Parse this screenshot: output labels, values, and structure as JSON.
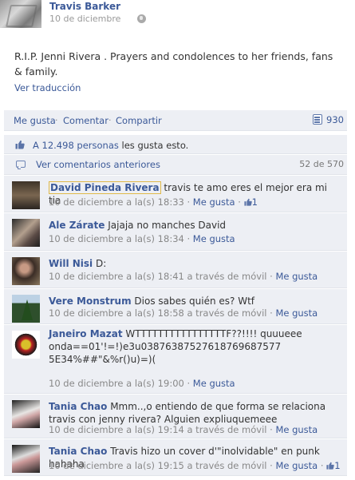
{
  "post": {
    "author": "Travis Barker",
    "date": "10 de diciembre",
    "text": "R.I.P. Jenni Rivera . Prayers and condolences to her friends, fans & family.",
    "translate_label": "Ver traducción"
  },
  "actions": {
    "like": "Me gusta",
    "comment": "Comentar",
    "share": "Compartir",
    "sep": "·",
    "share_count": "930"
  },
  "likes": {
    "count_link": "A 12.498 personas",
    "suffix": " les gusta esto."
  },
  "view_more": {
    "label": "Ver comentarios anteriores",
    "count": "52 de 570"
  },
  "comments": [
    {
      "name": "David Pineda Rivera",
      "text": "travis te amo eres el mejor era mi tia",
      "time": "10 de diciembre a la(s) 18:33",
      "sep": " · ",
      "like": "Me gusta",
      "likes": "1"
    },
    {
      "name": "Ale Zárate",
      "text": "Jajaja no manches David",
      "time": "10 de diciembre a la(s) 18:34",
      "sep": " · ",
      "like": "Me gusta"
    },
    {
      "name": "Will Nisi",
      "text": "D:",
      "time": "10 de diciembre a la(s) 18:41 a través de móvil",
      "sep": " · ",
      "like": "Me gusta"
    },
    {
      "name": "Vere Monstrum",
      "text": "Dios sabes quién es? Wtf",
      "time": "10 de diciembre a la(s) 18:58 a través de móvil",
      "sep": " · ",
      "like": "Me gusta"
    },
    {
      "name": "Janeiro Mazat",
      "text": "WTTTTTTTTTTTTTTTTF??!!!! quuueee onda==01'!=!)e3u03876387527618769687577 5E34%##\"&%r()u)=)(",
      "time": "10 de diciembre a la(s) 19:00",
      "sep": " · ",
      "like": "Me gusta"
    },
    {
      "name": "Tania Chao",
      "text": "Mmm..,o entiendo de que forma se relaciona travis con jenny rivera? Alguien expliuquemeee",
      "time": "10 de diciembre a la(s) 19:14 a través de móvil",
      "sep": " · ",
      "like": "Me gusta"
    },
    {
      "name": "Tania Chao",
      "text": "Travis hizo un cover d'\"inolvidable\" en punk hahaha",
      "time": "10 de diciembre a la(s) 19:15 a través de móvil",
      "sep": " · ",
      "like": "Me gusta",
      "likes": "1"
    }
  ],
  "colors": {
    "link": "#3b5998",
    "panel": "#edeff4",
    "meta": "#888888"
  }
}
